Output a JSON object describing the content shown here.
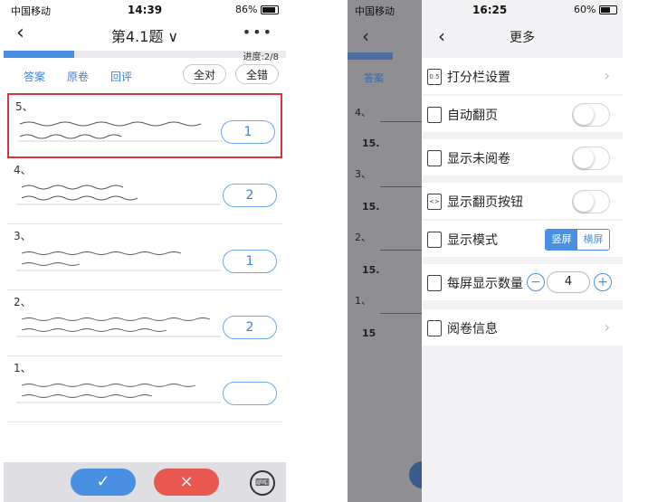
{
  "left": {
    "status": {
      "carrier": "中国移动",
      "time": "14:39",
      "battery": "86%"
    },
    "nav": {
      "back": "‹",
      "title": "第4.1题 ∨",
      "more": "•••"
    },
    "progress": {
      "text": "进度:2/8",
      "value": 0.25
    },
    "toolbar": {
      "answer": "答案",
      "original": "原卷",
      "review": "回评",
      "all_right": "全对",
      "all_wrong": "全错"
    },
    "questions": [
      {
        "num": "5、",
        "score": "1",
        "selected": true
      },
      {
        "num": "4、",
        "score": "2",
        "selected": false
      },
      {
        "num": "3、",
        "score": "1",
        "selected": false
      },
      {
        "num": "2、",
        "score": "2",
        "selected": false
      },
      {
        "num": "1、",
        "score": "",
        "selected": false
      }
    ],
    "bottom": {
      "confirm": "✓",
      "cancel": "×",
      "keyboard": "⌨"
    }
  },
  "right": {
    "status": {
      "carrier": "中国移动",
      "time": "16:25",
      "battery": "60%"
    },
    "bg_rows": [
      {
        "label": "答案"
      },
      {
        "label": "4、"
      },
      {
        "label": "15."
      },
      {
        "label": "3、"
      },
      {
        "label": "15."
      },
      {
        "label": "2、"
      },
      {
        "label": "15."
      },
      {
        "label": "1、"
      },
      {
        "label": "15"
      }
    ],
    "panel": {
      "back": "‹",
      "title": "更多",
      "items": [
        {
          "icon": "0.5",
          "label": "打分栏设置",
          "control": "chevron"
        },
        {
          "icon": "",
          "label": "自动翻页",
          "control": "toggle",
          "on": false
        },
        {
          "icon": "",
          "label": "显示未阅卷",
          "control": "toggle",
          "on": false
        },
        {
          "icon": "<>",
          "label": "显示翻页按钮",
          "control": "toggle",
          "on": false
        },
        {
          "icon": "",
          "label": "显示模式",
          "control": "segment",
          "options": [
            "竖屏",
            "横屏"
          ],
          "selected": "竖屏"
        },
        {
          "icon": "",
          "label": "每屏显示数量",
          "control": "stepper",
          "value": "4"
        },
        {
          "icon": "",
          "label": "阅卷信息",
          "control": "chevron"
        }
      ]
    },
    "accent": "#4a90e2"
  }
}
